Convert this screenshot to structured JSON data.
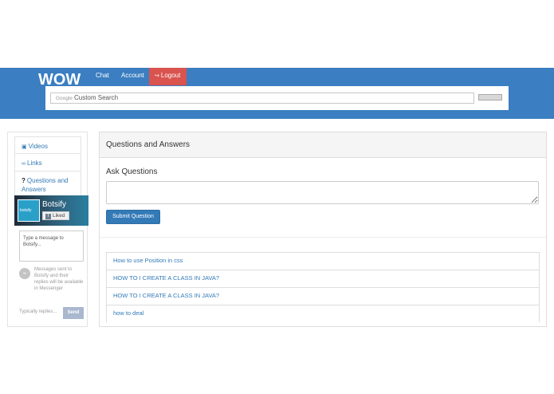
{
  "navbar": {
    "logo_text": "WOW",
    "links": [
      {
        "label": "Chat"
      },
      {
        "label": "Account"
      },
      {
        "label": "Logout",
        "icon": "logout-icon"
      }
    ],
    "colors": {
      "bar": "#3b7ec1",
      "logout": "#d9534f"
    }
  },
  "search": {
    "brand": "Google",
    "placeholder": "Custom Search"
  },
  "sidebar": {
    "items": [
      {
        "label": "Videos",
        "icon": "video-icon"
      },
      {
        "label": "Links",
        "icon": "link-icon"
      },
      {
        "prefix": "?",
        "label": "Questions and Answers",
        "icon": "question-icon"
      }
    ]
  },
  "messenger": {
    "page_name": "Botsify",
    "avatar_text": "botsify",
    "liked_label": "Liked",
    "message_placeholder": "Type a message to Botsify...",
    "note": "Messages sent to Botsify and their replies will be available in Messenger",
    "reply_hint": "Typically replies...",
    "send_label": "Send"
  },
  "panel": {
    "title": "Questions and Answers",
    "ask_label": "Ask Questions",
    "submit_label": "Submit Question",
    "questions": [
      {
        "text": "How to use Position in css"
      },
      {
        "text": "HOW TO I CREATE A CLASS IN JAVA?"
      },
      {
        "text": "HOW TO I CREATE A CLASS IN JAVA?"
      },
      {
        "text": "how to deal"
      }
    ]
  }
}
